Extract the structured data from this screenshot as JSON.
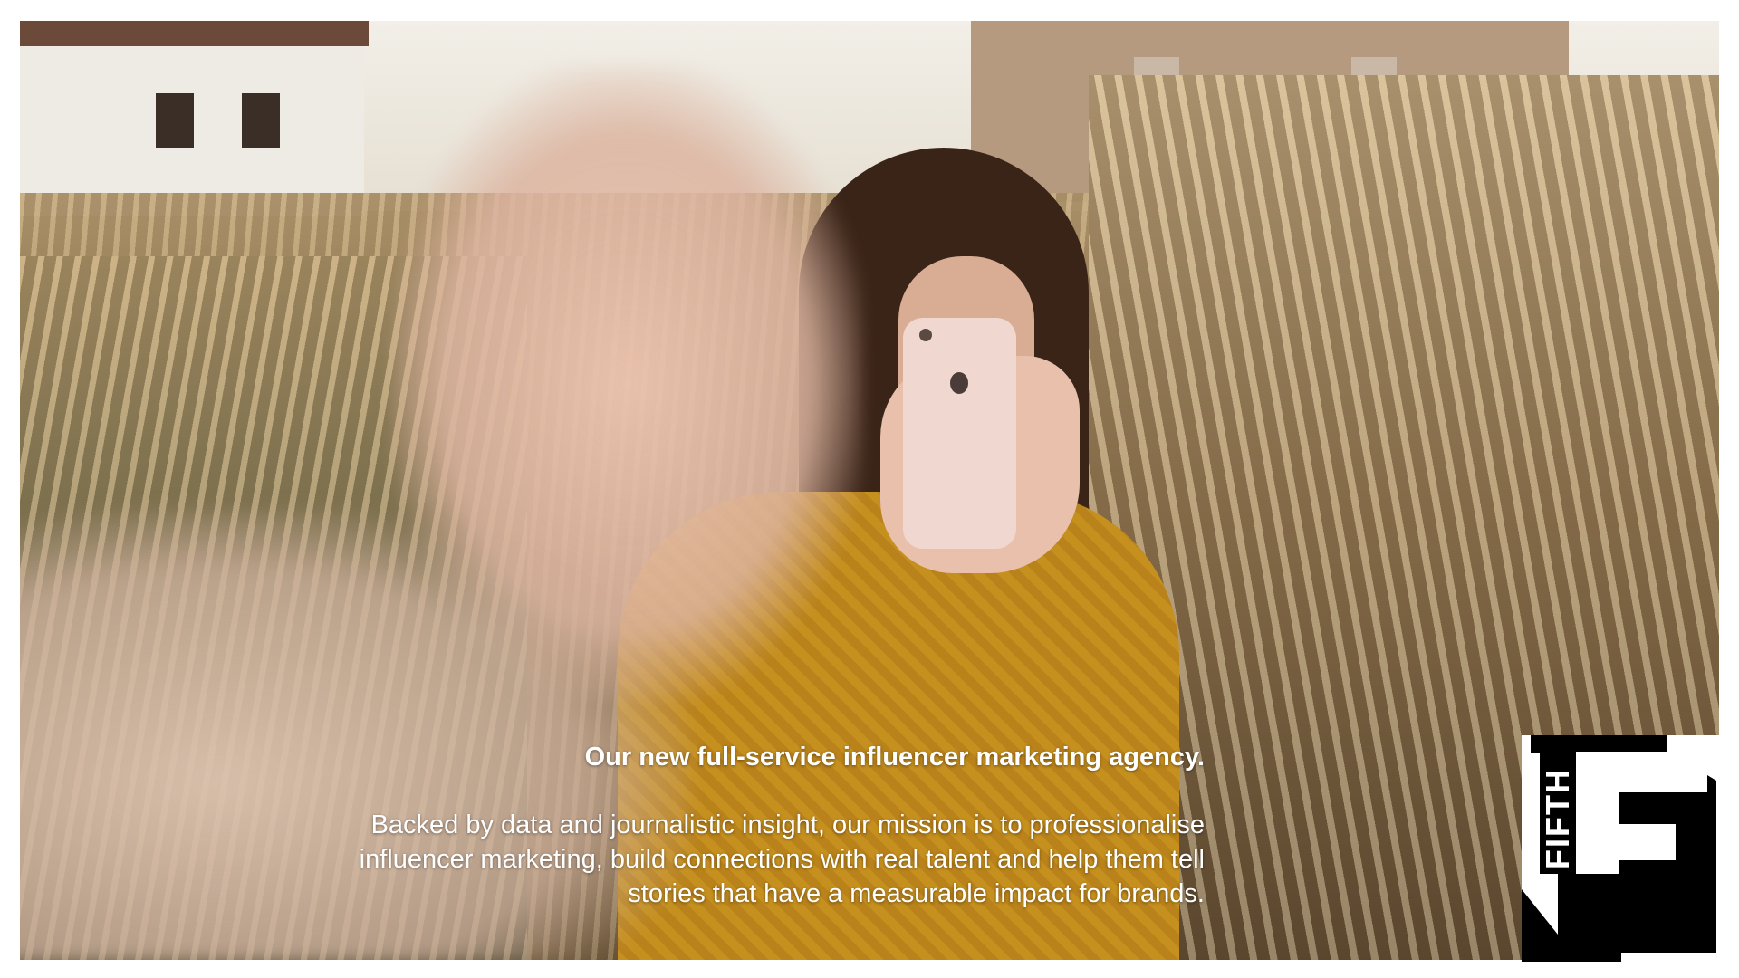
{
  "overlay": {
    "headline": "Our new full-service influencer marketing agency.",
    "body_lines": [
      "Backed by data and journalistic insight, our mission is to professionalise",
      "influencer marketing, build connections with real talent and help them tell",
      "stories that have a measurable impact for brands."
    ]
  },
  "logo": {
    "text": "FIFTH",
    "color": "#000000",
    "icon": "fifth-f-logo"
  },
  "colors": {
    "text": "#ffffff",
    "background": "#ffffff"
  }
}
